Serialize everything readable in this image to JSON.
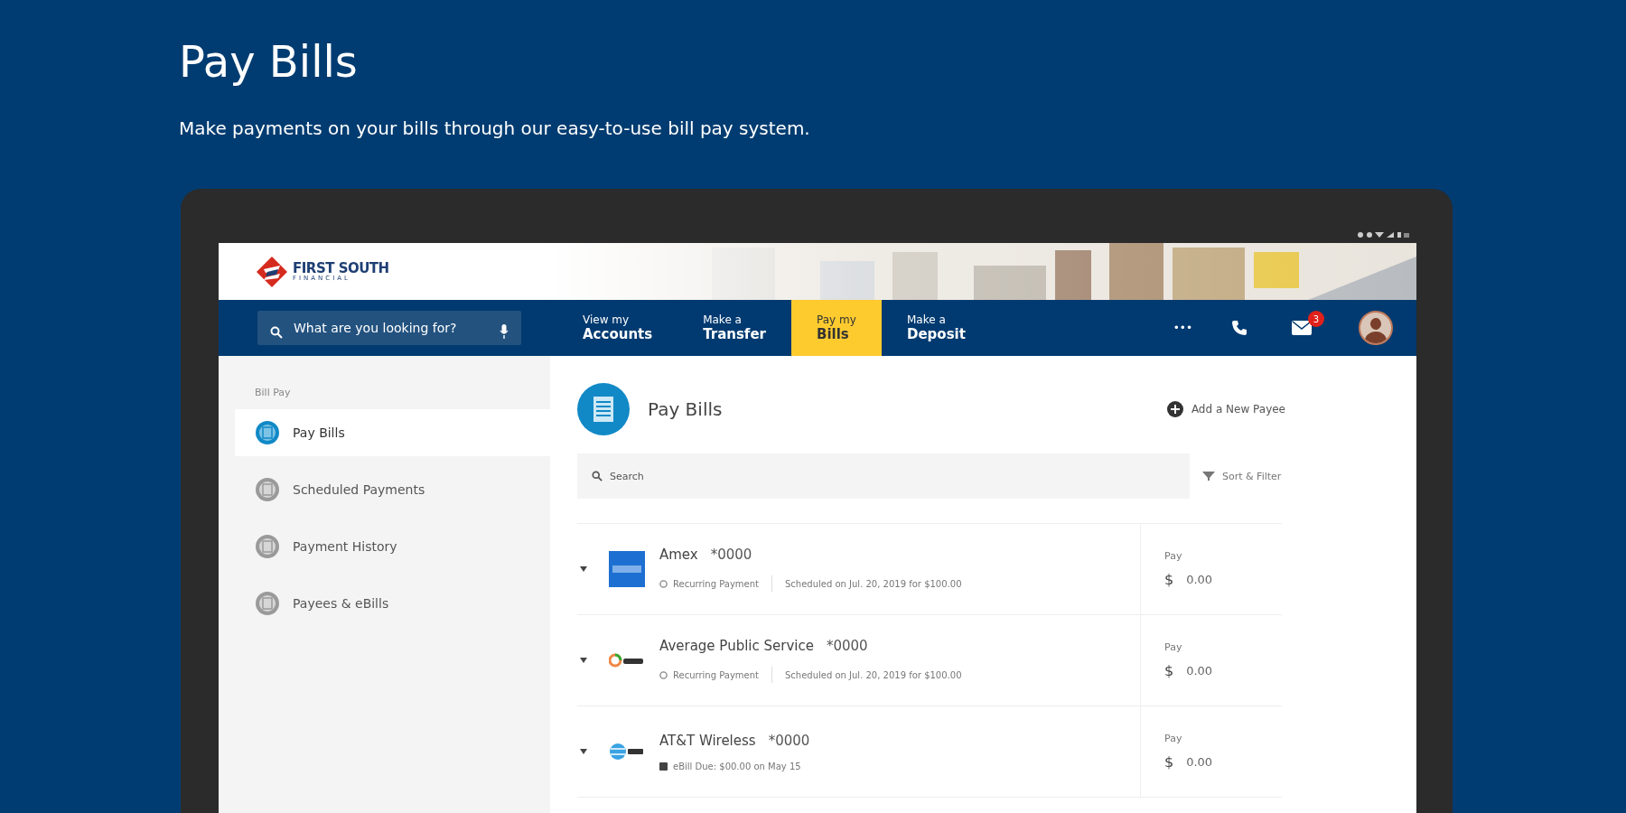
{
  "page": {
    "title": "Pay Bills",
    "subtitle": "Make payments on your bills through our easy-to-use bill pay system."
  },
  "app": {
    "logo": {
      "name": "FIRST SOUTH",
      "tagline": "FINANCIAL"
    },
    "search": {
      "placeholder": "What are you looking for?"
    },
    "nav": [
      {
        "line1": "View my",
        "line2": "Accounts",
        "selected": false
      },
      {
        "line1": "Make a",
        "line2": "Transfer",
        "selected": false
      },
      {
        "line1": "Pay my",
        "line2": "Bills",
        "selected": true
      },
      {
        "line1": "Make a",
        "line2": "Deposit",
        "selected": false
      }
    ],
    "more": "•••",
    "mail_badge": "3",
    "sidebar": {
      "heading": "Bill Pay",
      "items": [
        {
          "label": "Pay Bills",
          "selected": true
        },
        {
          "label": "Scheduled Payments",
          "selected": false
        },
        {
          "label": "Payment History",
          "selected": false
        },
        {
          "label": "Payees & eBills",
          "selected": false
        }
      ]
    },
    "main": {
      "title": "Pay Bills",
      "add_payee": "Add a New Payee",
      "search": {
        "placeholder": "Search"
      },
      "sort_filter": "Sort & Filter",
      "payees": [
        {
          "name": "Amex",
          "account": "*0000",
          "kind": "amex",
          "note": "Recurring Payment",
          "schedule": "Scheduled on Jul. 20, 2019 for $100.00",
          "pay_label": "Pay",
          "currency": "$",
          "amount": "0.00"
        },
        {
          "name": "Average Public Service",
          "account": "*0000",
          "kind": "aps",
          "note": "Recurring Payment",
          "schedule": "Scheduled on Jul. 20, 2019 for $100.00",
          "pay_label": "Pay",
          "currency": "$",
          "amount": "0.00"
        },
        {
          "name": "AT&T Wireless",
          "account": "*0000",
          "kind": "att",
          "note": "eBill Due: $00.00 on May 15",
          "pay_label": "Pay",
          "currency": "$",
          "amount": "0.00"
        }
      ]
    }
  }
}
